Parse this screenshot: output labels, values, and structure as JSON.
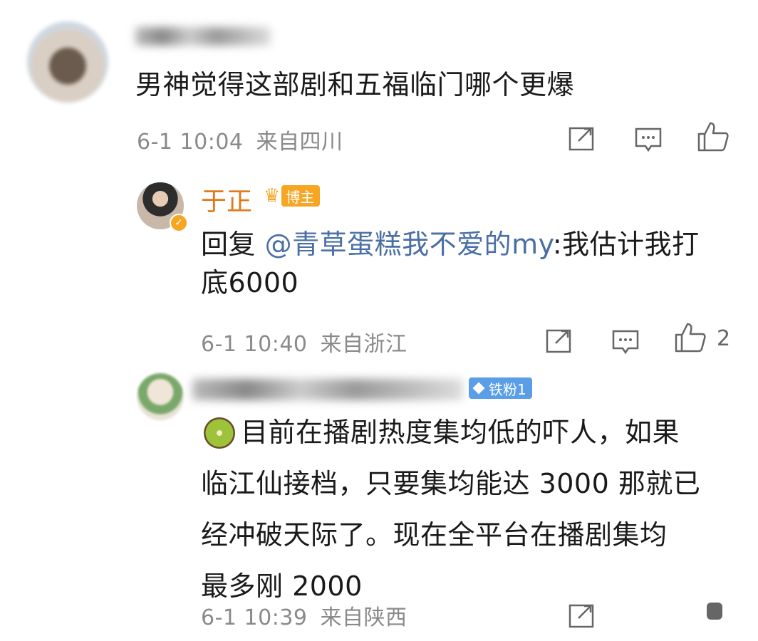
{
  "comment1": {
    "text": "男神觉得这部剧和五福临门哪个更爆",
    "time": "6-1 10:04",
    "location": "来自四川"
  },
  "reply1": {
    "author": "于正",
    "badge": "博主",
    "reply_prefix": "回复",
    "mention": "@青草蛋糕我不爱的my",
    "text_line1": ":我估计我打",
    "text_line2": "底6000",
    "time": "6-1 10:40",
    "location": "来自浙江",
    "like_count": "2"
  },
  "reply2": {
    "badge": "铁粉1",
    "lines": [
      "目前在播剧热度集均低的吓人，如果",
      "临江仙接档，只要集均能达 3000 那就已",
      "经冲破天际了。现在全平台在播剧集均",
      "最多刚 2000"
    ],
    "time": "6-1 10:39",
    "location": "来自陕西"
  },
  "colors": {
    "mention": "#4a6fa5",
    "author": "#e07a1a",
    "host_badge": "#f6a623",
    "fan_badge": "#5a9ee8",
    "meta": "#8a8a8a"
  }
}
